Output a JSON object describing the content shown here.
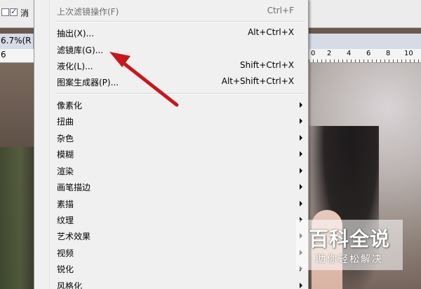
{
  "options_bar": {
    "checkbox_checked": true,
    "label": "消"
  },
  "document": {
    "zoom_title": "6.7%(R",
    "ruler_left_number": "6",
    "ruler_numbers": [
      "0",
      "2",
      "4",
      "6",
      "8",
      "10"
    ]
  },
  "menu": {
    "last_filter": {
      "label": "上次滤镜操作(F)",
      "shortcut": "Ctrl+F"
    },
    "group1": [
      {
        "label": "抽出(X)...",
        "shortcut": "Alt+Ctrl+X"
      },
      {
        "label": "滤镜库(G)...",
        "shortcut": ""
      },
      {
        "label": "液化(L)...",
        "shortcut": "Shift+Ctrl+X"
      },
      {
        "label": "图案生成器(P)...",
        "shortcut": "Alt+Shift+Ctrl+X"
      }
    ],
    "submenus": [
      {
        "label": "像素化"
      },
      {
        "label": "扭曲"
      },
      {
        "label": "杂色"
      },
      {
        "label": "模糊"
      },
      {
        "label": "渲染"
      },
      {
        "label": "画笔描边"
      },
      {
        "label": "素描"
      },
      {
        "label": "纹理"
      },
      {
        "label": "艺术效果"
      },
      {
        "label": "视频"
      },
      {
        "label": "锐化"
      },
      {
        "label": "风格化"
      }
    ]
  },
  "annotation": {
    "color": "#c8161d"
  },
  "watermark": {
    "title": "百科全说",
    "subtitle": "助你轻松解决"
  }
}
